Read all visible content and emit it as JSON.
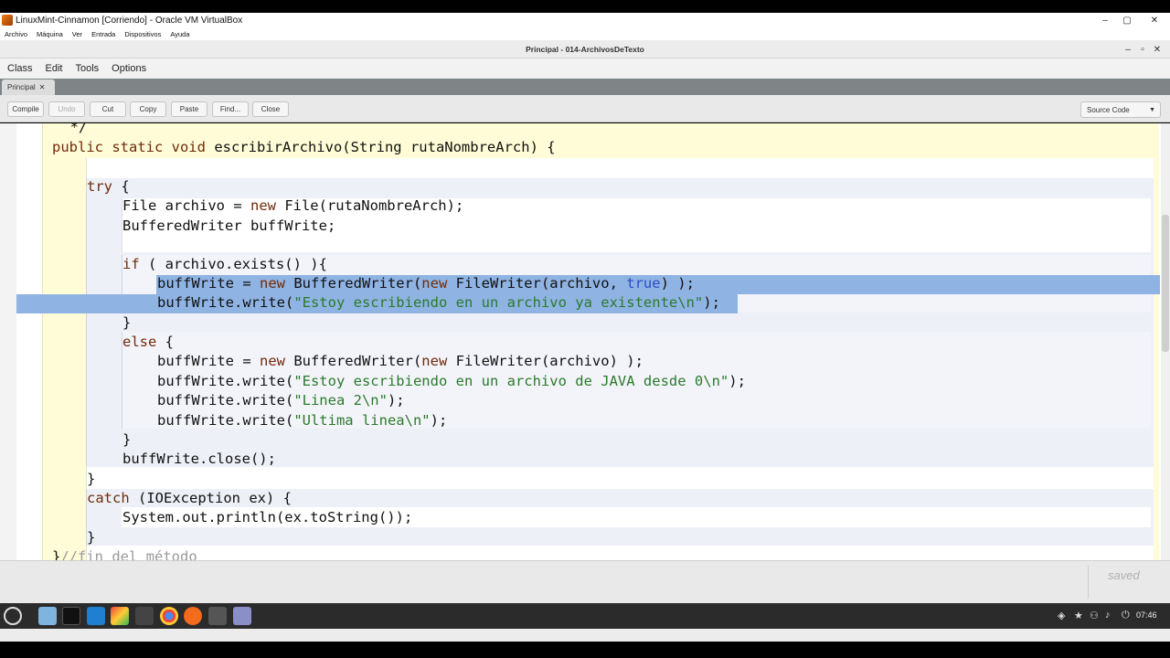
{
  "host_window": {
    "title": "LinuxMint-Cinnamon [Corriendo] - Oracle VM VirtualBox",
    "menu": [
      "Archivo",
      "Máquina",
      "Ver",
      "Entrada",
      "Dispositivos",
      "Ayuda"
    ]
  },
  "editor_window": {
    "title": "Principal - 014-ArchivosDeTexto",
    "menu": [
      "Class",
      "Edit",
      "Tools",
      "Options"
    ],
    "tab": "Principal",
    "toolbar": {
      "compile": "Compile",
      "undo": "Undo",
      "cut": "Cut",
      "copy": "Copy",
      "paste": "Paste",
      "find": "Find...",
      "close": "Close"
    },
    "view_select": "Source Code",
    "status": "saved"
  },
  "code": {
    "l01": "  */",
    "l02a": "public static void ",
    "l02b": "escribirArchivo(String rutaNombreArch) {",
    "l04a": "try",
    "l04b": " {",
    "l05a": "File archivo = ",
    "l05b": "new",
    "l05c": " File(rutaNombreArch);",
    "l06": "BufferedWriter buffWrite;",
    "l08a": "if",
    "l08b": " ( archivo.exists() ){",
    "l09a": "buffWrite = ",
    "l09b": "new",
    "l09c": " BufferedWriter(",
    "l09d": "new",
    "l09e": " FileWriter(archivo, ",
    "l09f": "true",
    "l09g": ") );",
    "l10a": "buffWrite.write(",
    "l10b": "\"Estoy escribiendo en un archivo ya existente\\n\"",
    "l10c": ");",
    "l11": "}",
    "l12a": "else",
    "l12b": " {",
    "l13a": "buffWrite = ",
    "l13b": "new",
    "l13c": " BufferedWriter(",
    "l13d": "new",
    "l13e": " FileWriter(archivo) );",
    "l14a": "buffWrite.write(",
    "l14b": "\"Estoy escribiendo en un archivo de JAVA desde 0\\n\"",
    "l14c": ");",
    "l15a": "buffWrite.write(",
    "l15b": "\"Linea 2\\n\"",
    "l15c": ");",
    "l16a": "buffWrite.write(",
    "l16b": "\"Ultima linea\\n\"",
    "l16c": ");",
    "l17": "}",
    "l18": "buffWrite.close();",
    "l19": "}",
    "l20a": "catch",
    "l20b": " (IOException ex) {",
    "l21": "System.out.println(ex.toString());",
    "l22": "}",
    "l23a": "}",
    "l23b": "//fin del método"
  },
  "taskbar": {
    "clock": "07:46"
  },
  "colors": {
    "keyword": "#702b0a",
    "string": "#2a7a2a",
    "literal": "#2e4ec8",
    "selection": "#8fb3e3",
    "method_scope": "#fffcd7"
  }
}
